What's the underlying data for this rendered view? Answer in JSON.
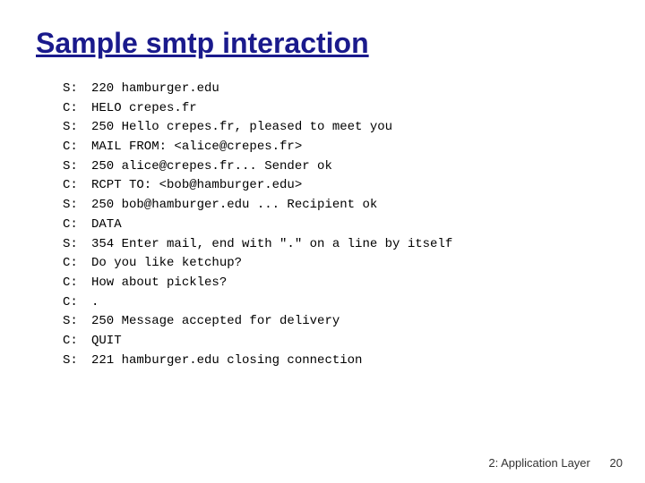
{
  "title": "Sample smtp interaction",
  "lines": [
    {
      "role": "S:",
      "text": "220 hamburger.edu"
    },
    {
      "role": "C:",
      "text": "HELO crepes.fr"
    },
    {
      "role": "S:",
      "text": "250  Hello crepes.fr, pleased to meet you"
    },
    {
      "role": "C:",
      "text": "MAIL FROM: <alice@crepes.fr>"
    },
    {
      "role": "S:",
      "text": "250 alice@crepes.fr... Sender ok"
    },
    {
      "role": "C:",
      "text": "RCPT TO: <bob@hamburger.edu>"
    },
    {
      "role": "S:",
      "text": "250 bob@hamburger.edu ... Recipient ok"
    },
    {
      "role": "C:",
      "text": "DATA"
    },
    {
      "role": "S:",
      "text": "354 Enter mail, end with \".\" on a line by itself"
    },
    {
      "role": "C:",
      "text": "Do you like ketchup?"
    },
    {
      "role": "C:",
      "text": "   How about pickles?"
    },
    {
      "role": "C:",
      "text": "."
    },
    {
      "role": "S:",
      "text": "250 Message accepted for delivery"
    },
    {
      "role": "C:",
      "text": "QUIT"
    },
    {
      "role": "S:",
      "text": "221 hamburger.edu closing connection"
    }
  ],
  "footer": {
    "chapter": "2: Application Layer",
    "page": "20"
  }
}
